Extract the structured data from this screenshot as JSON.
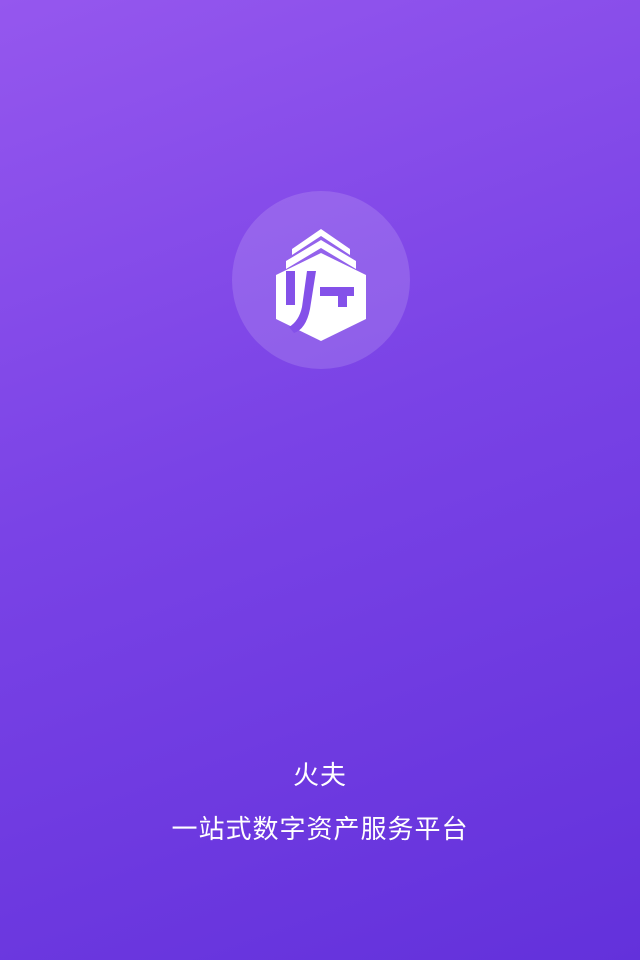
{
  "splash": {
    "logo_icon": "huofu-logo-icon",
    "app_name": "火夫",
    "slogan": "一站式数字资产服务平台",
    "background_gradient": [
      "#9557ee",
      "#6331db"
    ],
    "text_color": "#ffffff"
  }
}
